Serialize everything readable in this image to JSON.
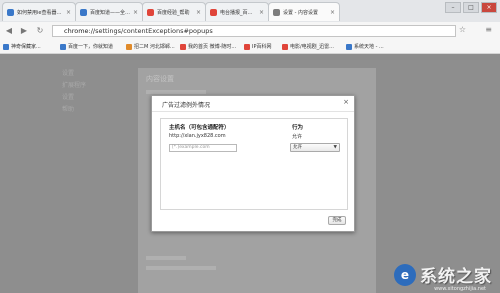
{
  "tabs": [
    {
      "title": "如何禁用ie查看器全屏...",
      "color": "#3a78c9",
      "active": false
    },
    {
      "title": "百度知道——全球最大中文...",
      "color": "#3a78c9",
      "active": false
    },
    {
      "title": "百度经验_帮助",
      "color": "#e0453a",
      "active": false
    },
    {
      "title": "电台播报_百度经验",
      "color": "#e0453a",
      "active": false
    },
    {
      "title": "设置 - 内容设置",
      "color": "#7d7d7d",
      "active": true
    }
  ],
  "toolbar": {
    "url_host": "chrome://",
    "url_path": "settings/contentExceptions#popups"
  },
  "bookmarks": [
    {
      "label": "神奇保藏家...",
      "color": "#3a78c9"
    },
    {
      "label": "百度一下，你就知道",
      "color": "#3a78c9"
    },
    {
      "label": "招二M 河北邯郸...",
      "color": "#e08a2a"
    },
    {
      "label": "我的首页 微博-随时...",
      "color": "#e0453a"
    },
    {
      "label": "IP百科网",
      "color": "#e0453a"
    },
    {
      "label": "电影/电视剧_迅雷...",
      "color": "#e0453a"
    },
    {
      "label": "系统天地 - ...",
      "color": "#3a78c9"
    }
  ],
  "background_text": {
    "left_items": [
      "设置",
      "扩展程序",
      "设置",
      "帮助"
    ],
    "panel_title": "内容设置"
  },
  "dialog": {
    "title": "广告过滤例外情况",
    "close": "×",
    "col_host": "主机名（可包含通配符）",
    "col_action": "行为",
    "row_host": "http://xlan.jyx828.com",
    "row_action": "允许",
    "new_host_placeholder": "[*.]example.com",
    "new_action": "允许",
    "done": "完成"
  },
  "watermark": {
    "logo": "e",
    "text": "系统之家",
    "site": "www.xitongzhijia.net"
  }
}
